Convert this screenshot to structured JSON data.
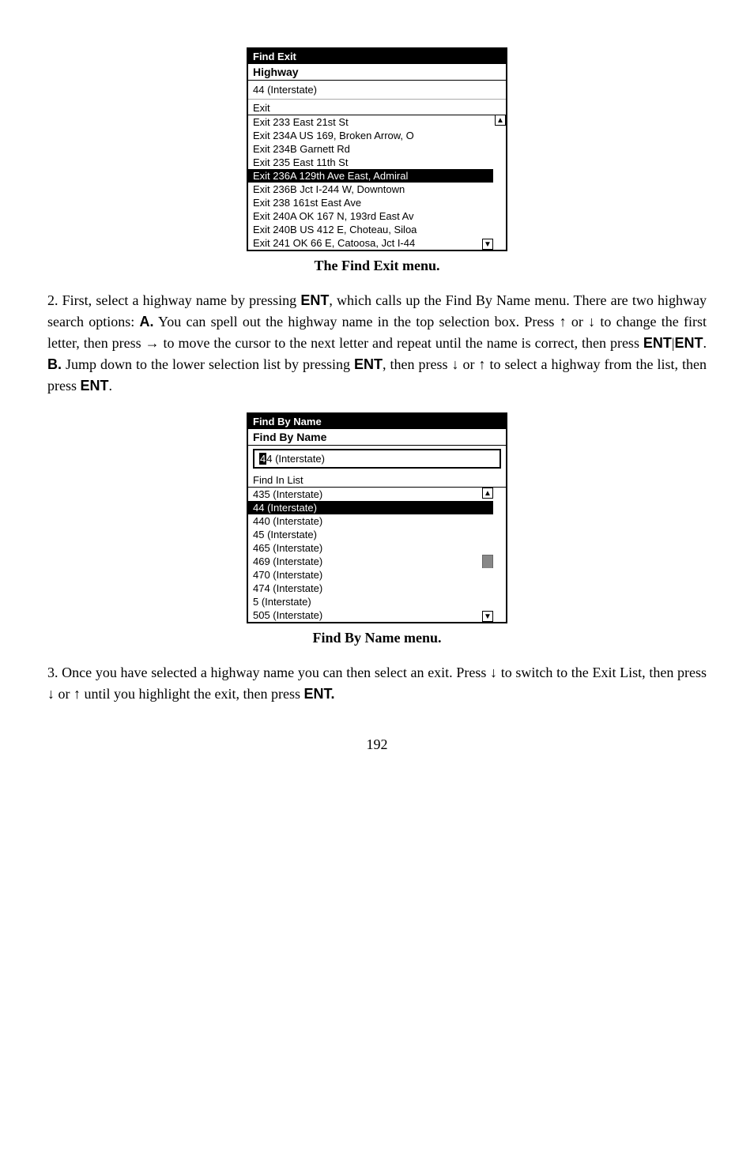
{
  "find_exit_menu": {
    "title": "Find Exit",
    "subtitle": "Highway",
    "current_value": "44 (Interstate)",
    "section_label": "Exit",
    "exits": [
      "Exit 233 East 21st St",
      "Exit 234A US 169, Broken Arrow, O",
      "Exit 234B Garnett Rd",
      "Exit 235 East 11th St",
      "Exit 236A 129th Ave East, Admiral",
      "Exit 236B Jct I-244 W, Downtown",
      "Exit 238 161st East Ave",
      "Exit 240A OK 167 N, 193rd East Av",
      "Exit 240B US 412 E, Choteau, Siloa",
      "Exit 241 OK 66 E, Catoosa, Jct I-44"
    ],
    "highlighted_index": 4,
    "caption": "The Find Exit menu."
  },
  "body_text_1": {
    "paragraph": "2. First, select a highway name by pressing ENT, which calls up the Find By Name menu. There are two highway search options: A. You can spell out the highway name in the top selection box. Press ↑ or ↓ to change the first letter, then press → to move the cursor to the next letter and repeat until the name is correct, then press ENT|ENT. B. Jump down to the lower selection list by pressing ENT, then press ↓ or ↑ to select a highway from the list, then press ENT."
  },
  "find_by_name_menu": {
    "title": "Find By Name",
    "subtitle": "Find By Name",
    "input_value": "44 (Interstate)",
    "input_cursor": "4",
    "section_label": "Find In List",
    "items": [
      "435 (Interstate)",
      "44 (Interstate)",
      "440 (Interstate)",
      "45 (Interstate)",
      "465 (Interstate)",
      "469 (Interstate)",
      "470 (Interstate)",
      "474 (Interstate)",
      "5 (Interstate)",
      "505 (Interstate)"
    ],
    "highlighted_index": 1,
    "caption": "Find By Name menu."
  },
  "body_text_2": {
    "paragraph": "3. Once you have selected a highway name you can then select an exit. Press ↓ to switch to the Exit List, then press ↓ or ↑ until you highlight the exit, then press ENT."
  },
  "page_number": "192"
}
